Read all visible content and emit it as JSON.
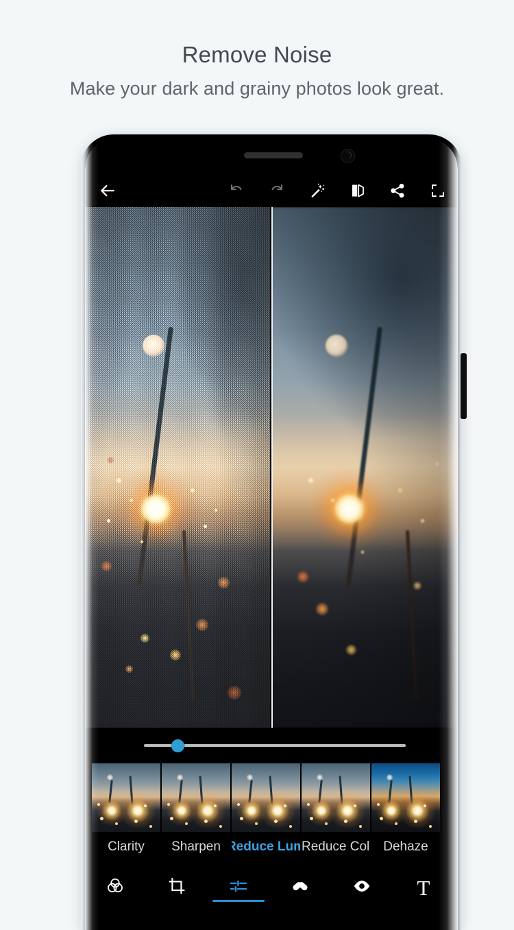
{
  "promo": {
    "title": "Remove Noise",
    "subtitle": "Make your dark and grainy photos look great."
  },
  "theme": {
    "page_background": "#f4f7f8",
    "title_color": "#414a51",
    "subtitle_color": "#5c666e",
    "accent_blue": "#2e9fd4",
    "nav_active_blue": "#2e90d6",
    "app_background": "#000000"
  },
  "phone": {
    "device_chrome": "curved-edge-android-phone",
    "speaker_grille": "speaker-grille",
    "front_camera": "front-camera",
    "side_button": "power-button"
  },
  "toolbar": {
    "items": [
      {
        "name": "back-arrow-icon",
        "label": "Back",
        "state": "enabled"
      },
      {
        "name": "undo-icon",
        "label": "Undo",
        "state": "disabled"
      },
      {
        "name": "redo-icon",
        "label": "Redo",
        "state": "disabled"
      },
      {
        "name": "magic-wand-icon",
        "label": "Auto Enhance",
        "state": "enabled"
      },
      {
        "name": "before-after-compare-icon",
        "label": "Compare",
        "state": "enabled"
      },
      {
        "name": "share-icon",
        "label": "Share",
        "state": "enabled"
      },
      {
        "name": "export-icon",
        "label": "Export",
        "state": "enabled"
      }
    ]
  },
  "photo": {
    "subject": "sparkler at dusk",
    "compare_mode": "split-view",
    "left_label": "noisy original",
    "right_label": "noise reduced",
    "divider_color": "#f2f4f6"
  },
  "slider": {
    "name": "reduce-luminance-noise-slider",
    "value_percent": 13,
    "min": 0,
    "max": 100,
    "track_color": "#b9bdc0",
    "knob_color": "#2e9fd4"
  },
  "filmstrip": {
    "selected_index": 2,
    "items": [
      {
        "label": "Clarity",
        "thumb": "sparkler-thumb"
      },
      {
        "label": "Sharpen",
        "thumb": "sparkler-thumb"
      },
      {
        "label": "Reduce Lum",
        "thumb": "sparkler-thumb"
      },
      {
        "label": "Reduce Col..",
        "thumb": "sparkler-thumb"
      },
      {
        "label": "Dehaze",
        "thumb": "sparkler-thumb-dehaze"
      }
    ]
  },
  "bottom_nav": {
    "active_index": 2,
    "items": [
      {
        "name": "looks-icon",
        "label": "Looks"
      },
      {
        "name": "crop-icon",
        "label": "Crop"
      },
      {
        "name": "adjust-sliders-icon",
        "label": "Adjust"
      },
      {
        "name": "heal-icon",
        "label": "Heal"
      },
      {
        "name": "red-eye-icon",
        "label": "Red Eye"
      },
      {
        "name": "text-icon",
        "label": "Text"
      }
    ]
  }
}
